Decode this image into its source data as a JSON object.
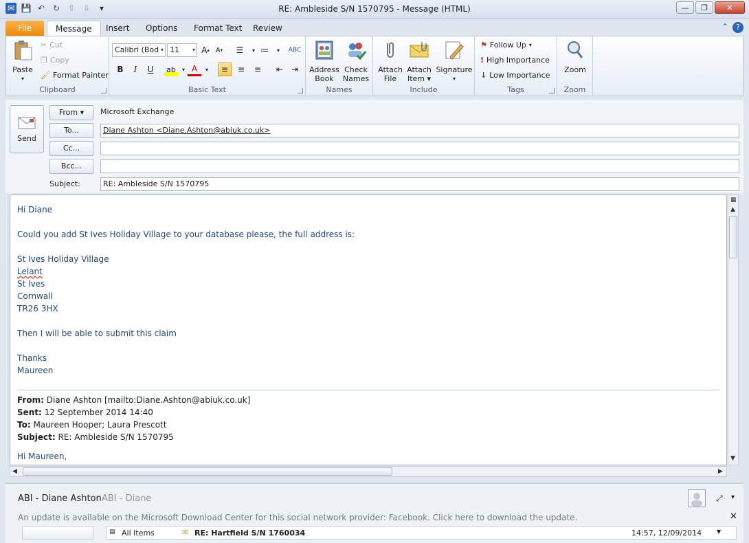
{
  "window": {
    "title": "RE: Ambleside  S/N  1570795  -  Message (HTML)"
  },
  "tabs": [
    "File",
    "Message",
    "Insert",
    "Options",
    "Format Text",
    "Review"
  ],
  "ribbon": {
    "clipboard": {
      "label": "Clipboard",
      "paste": "Paste",
      "cut": "Cut",
      "copy": "Copy",
      "format_painter": "Format Painter"
    },
    "basic_text": {
      "label": "Basic Text",
      "font": "Calibri (Bod",
      "size": "11"
    },
    "names": {
      "label": "Names",
      "address_book": [
        "Address",
        "Book"
      ],
      "check_names": [
        "Check",
        "Names"
      ]
    },
    "include": {
      "label": "Include",
      "attach_file": [
        "Attach",
        "File"
      ],
      "attach_item": [
        "Attach",
        "Item"
      ],
      "signature": "Signature"
    },
    "tags": {
      "label": "Tags",
      "follow_up": "Follow Up",
      "high": "High Importance",
      "low": "Low Importance"
    },
    "zoom": {
      "label": "Zoom",
      "zoom": "Zoom"
    }
  },
  "header": {
    "send": "Send",
    "from_label": "From",
    "from_value": "Microsoft Exchange",
    "to_label": "To...",
    "to_value": "Diane Ashton <Diane.Ashton@abiuk.co.uk>",
    "cc_label": "Cc...",
    "cc_value": "",
    "bcc_label": "Bcc...",
    "bcc_value": "",
    "subject_label": "Subject:",
    "subject_value": "RE: Ambleside  S/N  1570795"
  },
  "body": {
    "greeting": "Hi Diane",
    "request": "Could you add St Ives Holiday Village to your database please, the full address is:",
    "address": [
      "St Ives Holiday Village",
      "Lelant",
      "St Ives",
      "Cornwall",
      "TR26 3HX"
    ],
    "closing_line": "Then I will be able to submit this claim",
    "thanks": "Thanks",
    "signature": "Maureen",
    "quoted": {
      "from_label": "From:",
      "from_value": " Diane Ashton [mailto:Diane.Ashton@abiuk.co.uk]",
      "sent_label": "Sent:",
      "sent_value": " 12 September 2014 14:40",
      "to_label": "To:",
      "to_value": " Maureen Hooper; Laura Prescott",
      "subject_label": "Subject:",
      "subject_value": " RE: Ambleside S/N 1570795",
      "greeting": "Hi Maureen,"
    }
  },
  "people_pane": {
    "name": "ABI - Diane Ashton",
    "sub": "ABI - Diane",
    "update_msg": "An update is available on the Microsoft Download Center for this social network provider: Facebook. Click here to download the update.",
    "list_filter": "All Items",
    "item_subject": "RE: Hartfield S/N 1760034",
    "item_time": "14:57, 12/09/2014"
  }
}
